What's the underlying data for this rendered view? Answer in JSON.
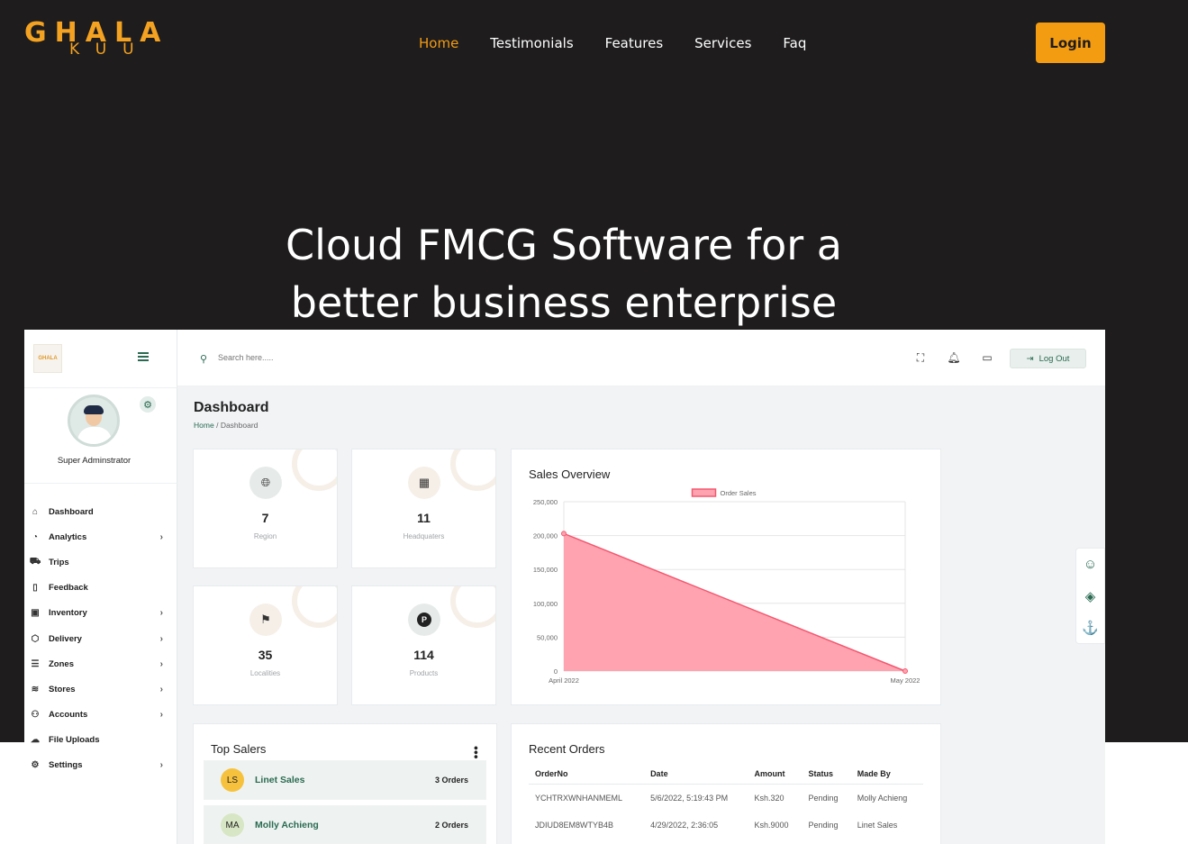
{
  "brand": {
    "logo_line1": "GHALA",
    "logo_line2": "KUU",
    "accent_color": "#f39c12"
  },
  "nav": {
    "items": [
      {
        "label": "Home",
        "active": true
      },
      {
        "label": "Testimonials",
        "active": false
      },
      {
        "label": "Features",
        "active": false
      },
      {
        "label": "Services",
        "active": false
      },
      {
        "label": "Faq",
        "active": false
      }
    ],
    "login_label": "Login"
  },
  "hero": {
    "title_line1": "Cloud FMCG Software for a",
    "title_line2": "better business enterprise"
  },
  "dashboard": {
    "sidebar": {
      "logo_text": "GHALA",
      "role": "Super Adminstrator",
      "items": [
        {
          "label": "Dashboard",
          "icon": "home-icon",
          "has_submenu": false
        },
        {
          "label": "Analytics",
          "icon": "pie-chart-icon",
          "has_submenu": true
        },
        {
          "label": "Trips",
          "icon": "truck-icon",
          "has_submenu": false
        },
        {
          "label": "Feedback",
          "icon": "tablet-icon",
          "has_submenu": false
        },
        {
          "label": "Inventory",
          "icon": "box-icon",
          "has_submenu": true
        },
        {
          "label": "Delivery",
          "icon": "package-icon",
          "has_submenu": true
        },
        {
          "label": "Zones",
          "icon": "server-icon",
          "has_submenu": true
        },
        {
          "label": "Stores",
          "icon": "layers-icon",
          "has_submenu": true
        },
        {
          "label": "Accounts",
          "icon": "users-icon",
          "has_submenu": true
        },
        {
          "label": "File Uploads",
          "icon": "cloud-upload-icon",
          "has_submenu": false
        },
        {
          "label": "Settings",
          "icon": "gear-icon",
          "has_submenu": true
        }
      ]
    },
    "topbar": {
      "search_placeholder": "Search here.....",
      "logout_label": "Log Out"
    },
    "page_title": "Dashboard",
    "breadcrumb": {
      "home": "Home",
      "separator": "/",
      "current": "Dashboard"
    },
    "stats": [
      {
        "value": "7",
        "label": "Region",
        "icon": "globe-icon",
        "icon_bg": "#e6ebe9"
      },
      {
        "value": "11",
        "label": "Headquaters",
        "icon": "building-icon",
        "icon_bg": "#f6efe8"
      },
      {
        "value": "35",
        "label": "Localities",
        "icon": "flag-icon",
        "icon_bg": "#f6efe8"
      },
      {
        "value": "114",
        "label": "Products",
        "icon": "parking-icon",
        "icon_bg": "#e6ebe9"
      }
    ],
    "sales_overview": {
      "title": "Sales Overview"
    },
    "top_salers": {
      "title": "Top Salers",
      "items": [
        {
          "initials": "LS",
          "name": "Linet Sales",
          "orders": "3 Orders",
          "color": "#f6c23e"
        },
        {
          "initials": "MA",
          "name": "Molly Achieng",
          "orders": "2 Orders",
          "color": "#d7e6c4"
        }
      ]
    },
    "recent_orders": {
      "title": "Recent Orders",
      "columns": [
        "OrderNo",
        "Date",
        "Amount",
        "Status",
        "Made By"
      ],
      "rows": [
        [
          "YCHTRXWNHANMEML",
          "5/6/2022, 5:19:43 PM",
          "Ksh.320",
          "Pending",
          "Molly Achieng"
        ],
        [
          "JDIUD8EM8WTYB4B",
          "4/29/2022, 2:36:05",
          "Ksh.9000",
          "Pending",
          "Linet Sales"
        ]
      ]
    }
  },
  "chart_data": {
    "type": "area",
    "title": "Sales Overview",
    "categories": [
      "April 2022",
      "May 2022"
    ],
    "series": [
      {
        "name": "Order Sales",
        "values": [
          203000,
          0
        ],
        "color": "#f4586f",
        "fill": "#ffa3b1"
      }
    ],
    "yticks": [
      0,
      50000,
      100000,
      150000,
      200000,
      250000
    ],
    "ytick_labels": [
      "0",
      "50,000",
      "100,000",
      "150,000",
      "200,000",
      "250,000"
    ],
    "ylim": [
      0,
      250000
    ],
    "legend": "top-center",
    "grid": true
  }
}
